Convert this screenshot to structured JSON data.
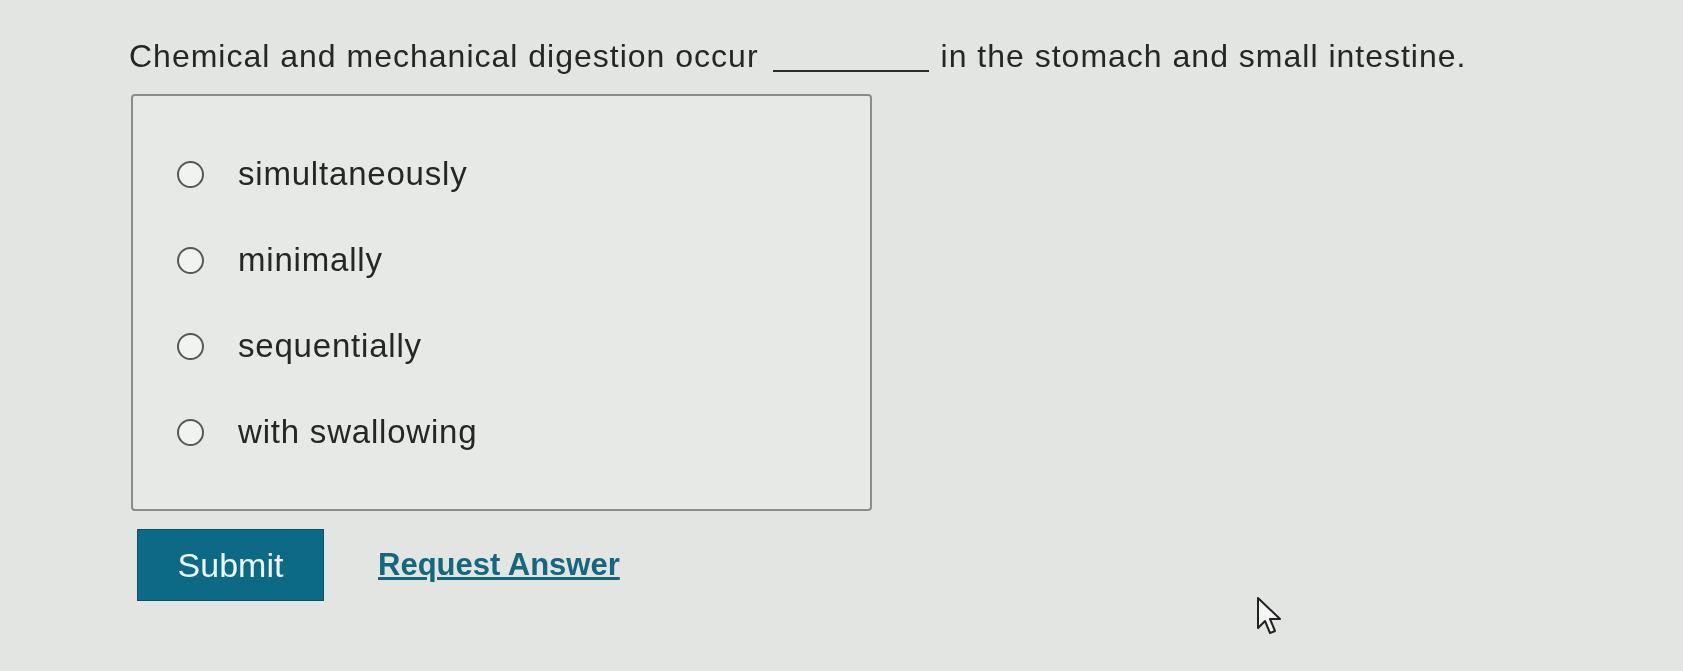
{
  "question": {
    "before_blank": "Chemical and mechanical digestion occur",
    "after_blank": "in the stomach and small intestine."
  },
  "options": [
    {
      "label": "simultaneously",
      "selected": false
    },
    {
      "label": "minimally",
      "selected": false
    },
    {
      "label": "sequentially",
      "selected": false
    },
    {
      "label": "with swallowing",
      "selected": false
    }
  ],
  "actions": [
    {
      "kind": "button",
      "label": "Submit"
    },
    {
      "kind": "link",
      "label": "Request Answer"
    }
  ]
}
